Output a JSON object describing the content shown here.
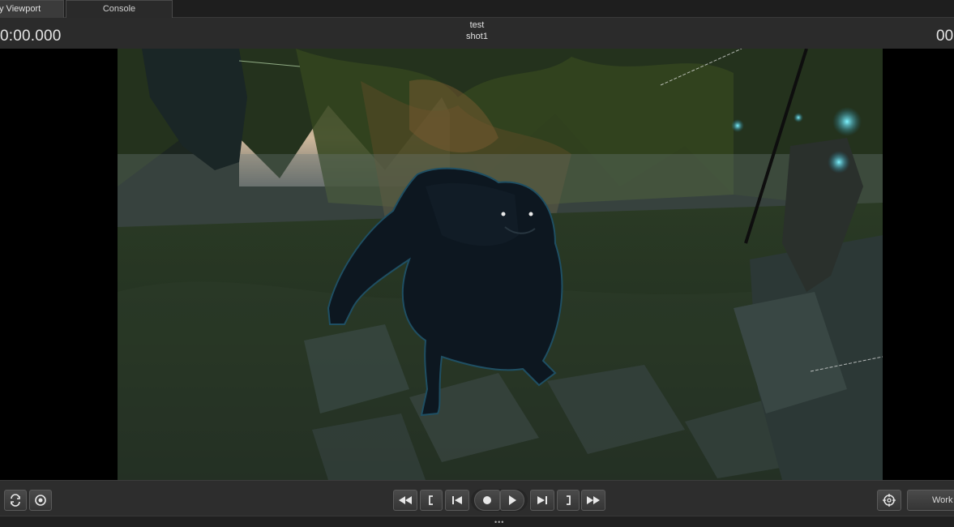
{
  "tabs": [
    {
      "label": "y Viewport",
      "active": true
    },
    {
      "label": "Console",
      "active": false
    }
  ],
  "header": {
    "time_left": "0:00.000",
    "time_right": "00",
    "session_title": "test",
    "shot_name": "shot1"
  },
  "toolbar": {
    "left_buttons": [
      "refresh-icon",
      "camera-target-icon"
    ],
    "transport": [
      "rewind-icon",
      "mark-in-icon",
      "skip-start-icon",
      "record-icon",
      "play-icon",
      "skip-end-icon",
      "mark-out-icon",
      "fast-forward-icon"
    ],
    "right_icon": "crosshair-icon",
    "work_label": "Work"
  },
  "statusbar": {
    "grip": "•••"
  }
}
